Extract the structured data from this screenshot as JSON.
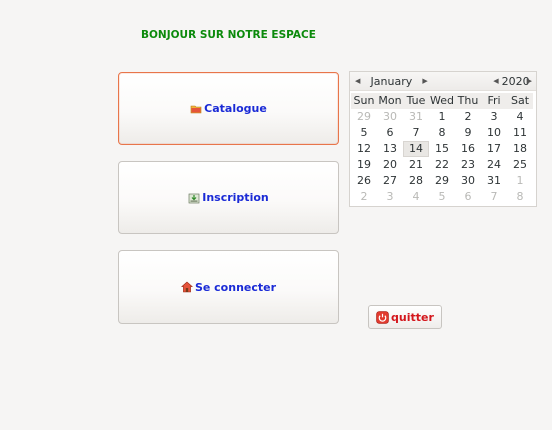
{
  "header": {
    "welcome": "BONJOUR SUR NOTRE ESPACE"
  },
  "buttons": {
    "catalogue": {
      "label": "Catalogue",
      "icon": "folder-icon"
    },
    "inscription": {
      "label": "Inscription",
      "icon": "download-icon"
    },
    "connect": {
      "label": "Se connecter",
      "icon": "home-icon"
    },
    "quit": {
      "label": "quitter",
      "icon": "power-icon"
    }
  },
  "calendar": {
    "month": "January",
    "year": "2020",
    "weekdays": [
      "Sun",
      "Mon",
      "Tue",
      "Wed",
      "Thu",
      "Fri",
      "Sat"
    ],
    "selected_day": "14",
    "weeks": [
      [
        {
          "d": "29",
          "dim": true
        },
        {
          "d": "30",
          "dim": true
        },
        {
          "d": "31",
          "dim": true
        },
        {
          "d": "1"
        },
        {
          "d": "2"
        },
        {
          "d": "3"
        },
        {
          "d": "4"
        }
      ],
      [
        {
          "d": "5"
        },
        {
          "d": "6"
        },
        {
          "d": "7"
        },
        {
          "d": "8"
        },
        {
          "d": "9"
        },
        {
          "d": "10"
        },
        {
          "d": "11"
        }
      ],
      [
        {
          "d": "12"
        },
        {
          "d": "13"
        },
        {
          "d": "14",
          "selected": true
        },
        {
          "d": "15"
        },
        {
          "d": "16"
        },
        {
          "d": "17"
        },
        {
          "d": "18"
        }
      ],
      [
        {
          "d": "19"
        },
        {
          "d": "20"
        },
        {
          "d": "21"
        },
        {
          "d": "22"
        },
        {
          "d": "23"
        },
        {
          "d": "24"
        },
        {
          "d": "25"
        }
      ],
      [
        {
          "d": "26"
        },
        {
          "d": "27"
        },
        {
          "d": "28"
        },
        {
          "d": "29"
        },
        {
          "d": "30"
        },
        {
          "d": "31"
        },
        {
          "d": "1",
          "dim": true
        }
      ],
      [
        {
          "d": "2",
          "dim": true
        },
        {
          "d": "3",
          "dim": true
        },
        {
          "d": "4",
          "dim": true
        },
        {
          "d": "5",
          "dim": true
        },
        {
          "d": "6",
          "dim": true
        },
        {
          "d": "7",
          "dim": true
        },
        {
          "d": "8",
          "dim": true
        }
      ]
    ]
  },
  "colors": {
    "welcome": "#0b8a0b",
    "button_text": "#1a2ad6",
    "quit_text": "#d4161c",
    "focus_border": "#e8754a"
  }
}
